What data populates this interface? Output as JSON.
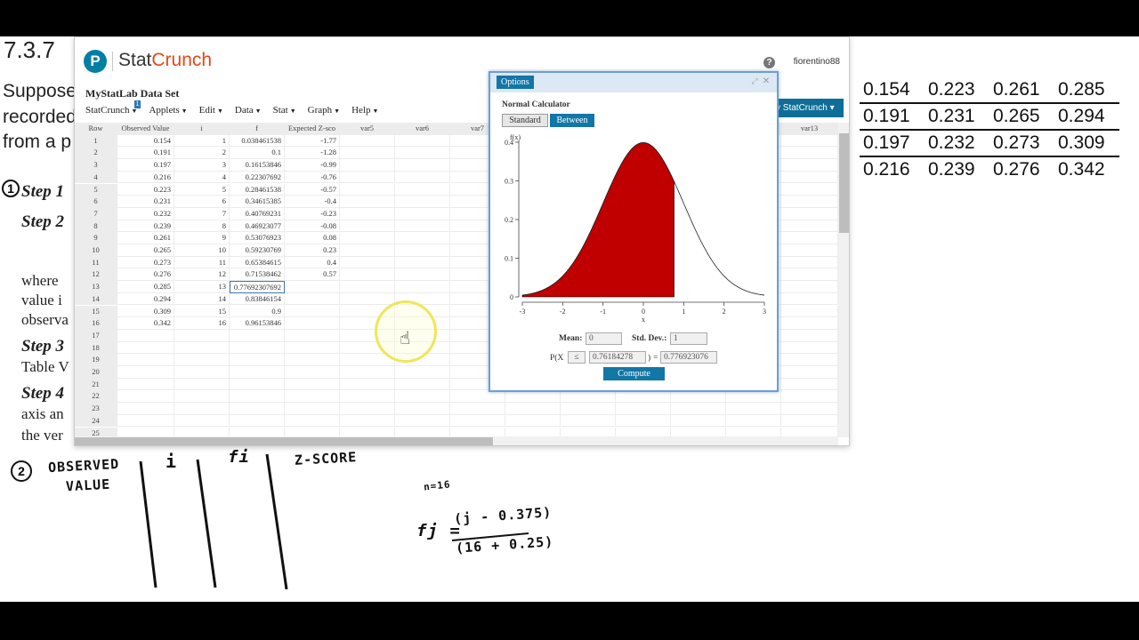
{
  "worksheet": {
    "problem_number": "7.3.7",
    "intro_lines": [
      "Suppose",
      "recorded",
      "from a p"
    ],
    "steps": [
      {
        "label": "Step 1"
      },
      {
        "label": "Step 2"
      },
      {
        "label": "Step 3"
      },
      {
        "label": "Step 4"
      }
    ],
    "step_texts": [
      "where",
      "value i",
      "observa",
      "Table V",
      "axis an",
      "the ver"
    ],
    "circled_numbers": [
      "1",
      "2"
    ],
    "values_table": [
      [
        "0.154",
        "0.223",
        "0.261",
        "0.285"
      ],
      [
        "0.191",
        "0.231",
        "0.265",
        "0.294"
      ],
      [
        "0.197",
        "0.232",
        "0.273",
        "0.309"
      ],
      [
        "0.216",
        "0.239",
        "0.276",
        "0.342"
      ]
    ],
    "handwriting": {
      "observed": "OBSERVED",
      "value": "VALUE",
      "i": "i",
      "fi": "fi",
      "zscore": "Z-SCORE",
      "n": "n=16",
      "formula_lhs": "fj =",
      "formula_num": "(j - 0.375)",
      "formula_den": "(16 + 0.25)"
    }
  },
  "statcrunch": {
    "logo_letter": "P",
    "brand_prefix": "Stat",
    "brand_accent": "Crunch",
    "help": "?",
    "username": "fiorentino88",
    "dataset_title": "MyStatLab Data Set",
    "badge": "1",
    "menus": [
      "StatCrunch",
      "Applets",
      "Edit",
      "Data",
      "Stat",
      "Graph",
      "Help"
    ],
    "mystat_button": "y StatCrunch ▾",
    "columns": [
      "Row",
      "Observed Value",
      "i",
      "f",
      "Expected Z-sco",
      "var5",
      "var6",
      "var7",
      "",
      "",
      "",
      "",
      "",
      "var13"
    ],
    "rows": [
      [
        "1",
        "0.154",
        "1",
        "0.038461538",
        "-1.77"
      ],
      [
        "2",
        "0.191",
        "2",
        "0.1",
        "-1.28"
      ],
      [
        "3",
        "0.197",
        "3",
        "0.16153846",
        "-0.99"
      ],
      [
        "4",
        "0.216",
        "4",
        "0.22307692",
        "-0.76"
      ],
      [
        "5",
        "0.223",
        "5",
        "0.28461538",
        "-0.57"
      ],
      [
        "6",
        "0.231",
        "6",
        "0.34615385",
        "-0.4"
      ],
      [
        "7",
        "0.232",
        "7",
        "0.40769231",
        "-0.23"
      ],
      [
        "8",
        "0.239",
        "8",
        "0.46923077",
        "-0.08"
      ],
      [
        "9",
        "0.261",
        "9",
        "0.53076923",
        "0.08"
      ],
      [
        "10",
        "0.265",
        "10",
        "0.59230769",
        "0.23"
      ],
      [
        "11",
        "0.273",
        "11",
        "0.65384615",
        "0.4"
      ],
      [
        "12",
        "0.276",
        "12",
        "0.71538462",
        "0.57"
      ],
      [
        "13",
        "0.285",
        "13",
        "0.77692307692",
        ""
      ],
      [
        "14",
        "0.294",
        "14",
        "0.83846154",
        ""
      ],
      [
        "15",
        "0.309",
        "15",
        "0.9",
        ""
      ],
      [
        "16",
        "0.342",
        "16",
        "0.96153846",
        ""
      ],
      [
        "17",
        "",
        "",
        "",
        ""
      ],
      [
        "18",
        "",
        "",
        "",
        ""
      ],
      [
        "19",
        "",
        "",
        "",
        ""
      ],
      [
        "20",
        "",
        "",
        "",
        ""
      ],
      [
        "21",
        "",
        "",
        "",
        ""
      ],
      [
        "22",
        "",
        "",
        "",
        ""
      ],
      [
        "23",
        "",
        "",
        "",
        ""
      ],
      [
        "24",
        "",
        "",
        "",
        ""
      ],
      [
        "25",
        "",
        "",
        "",
        ""
      ]
    ],
    "selected_cell": {
      "row": 13,
      "col": 3
    }
  },
  "normal_calc": {
    "options_label": "Options",
    "title": "Normal Calculator",
    "mode_standard": "Standard",
    "mode_between": "Between",
    "active_mode": "Between",
    "mean_label": "Mean:",
    "mean_value": "0",
    "sd_label": "Std. Dev.:",
    "sd_value": "1",
    "prob_prefix": "P(X",
    "operator": "≤",
    "x_value": "0.76184278",
    "prob_close": ")",
    "equals": "=",
    "prob_value": "0.776923076",
    "compute_label": "Compute",
    "chart_data": {
      "type": "area",
      "title": "",
      "ylabel": "f(x)",
      "xlabel": "x",
      "xlim": [
        -3,
        3
      ],
      "ylim": [
        0,
        0.4
      ],
      "x_ticks": [
        "-3",
        "-2",
        "-1",
        "0",
        "1",
        "2",
        "3"
      ],
      "y_ticks": [
        "0",
        "0.1",
        "0.2",
        "0.3",
        "0.4"
      ],
      "shaded_upper": 0.76184278,
      "shade_color": "#c00000"
    }
  }
}
